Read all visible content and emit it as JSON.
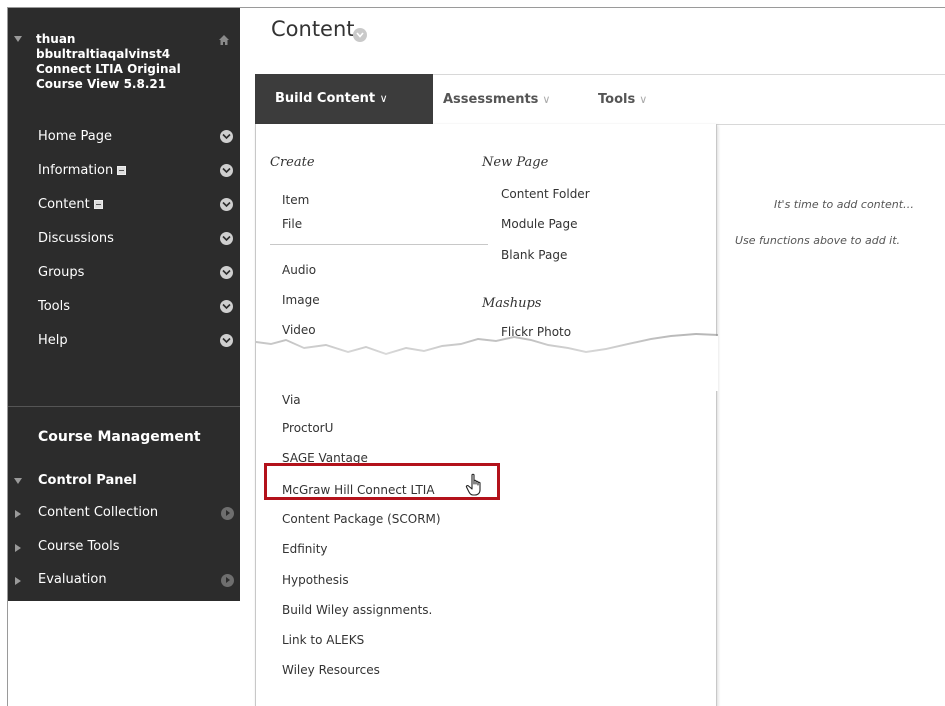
{
  "sidebar": {
    "course_title": "thuan bbultraltiaqalvinst4 Connect LTIA Original Course View 5.8.21",
    "items": [
      {
        "label": "Home Page"
      },
      {
        "label": "Information"
      },
      {
        "label": "Content"
      },
      {
        "label": "Discussions"
      },
      {
        "label": "Groups"
      },
      {
        "label": "Tools"
      },
      {
        "label": "Help"
      }
    ],
    "course_management": "Course Management",
    "control_panel": "Control Panel",
    "control_items": [
      {
        "label": "Content Collection"
      },
      {
        "label": "Course Tools"
      },
      {
        "label": "Evaluation"
      }
    ]
  },
  "main": {
    "page_title": "Content",
    "action_bar": {
      "build_content": "Build Content",
      "assessments": "Assessments",
      "tools": "Tools",
      "caret": "∨"
    },
    "empty": {
      "line1": "It's time to add content…",
      "line2": "Use functions above to add it."
    }
  },
  "dropdown": {
    "create_heading": "Create",
    "create_items": [
      "Item",
      "File",
      "Audio",
      "Image",
      "Video"
    ],
    "new_page_heading": "New Page",
    "new_page_items": [
      "Content Folder",
      "Module Page",
      "Blank Page"
    ],
    "mashups_heading": "Mashups",
    "mashups_partial": "Flickr Photo",
    "lower_items": [
      "Via",
      "ProctorU",
      "SAGE Vantage",
      "McGraw Hill Connect LTIA",
      "Content Package (SCORM)",
      "Edfinity",
      "Hypothesis",
      "Build Wiley assignments.",
      "Link to ALEKS",
      "Wiley Resources"
    ]
  },
  "colors": {
    "sidebar_bg": "#2c2c2c",
    "build_bg": "#3c3c3c",
    "highlight": "#b3121b"
  }
}
